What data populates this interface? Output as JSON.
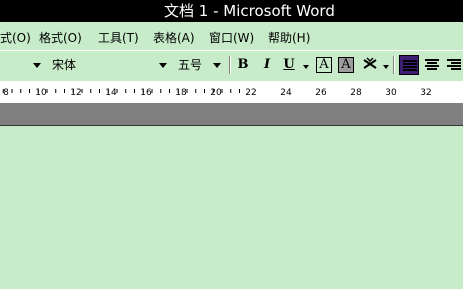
{
  "window": {
    "title": "文档 1 - Microsoft Word"
  },
  "menu": {
    "items": [
      {
        "label": "式(O)"
      },
      {
        "label": "格式(O)"
      },
      {
        "label": "工具(T)"
      },
      {
        "label": "表格(A)"
      },
      {
        "label": "窗口(W)"
      },
      {
        "label": "帮助(H)"
      }
    ]
  },
  "toolbar": {
    "font_name": "宋体",
    "font_size": "五号",
    "bold_label": "B",
    "italic_label": "I",
    "underline_label": "U",
    "char_border_label": "A",
    "char_shading_label": "A"
  },
  "ruler": {
    "labels": [
      "8",
      "10",
      "12",
      "14",
      "16",
      "18",
      "20",
      "22",
      "24",
      "26",
      "28",
      "30",
      "32"
    ]
  },
  "colors": {
    "background": "#c8ebca",
    "titlebar": "#000000",
    "active_align": "#3c1f74"
  }
}
